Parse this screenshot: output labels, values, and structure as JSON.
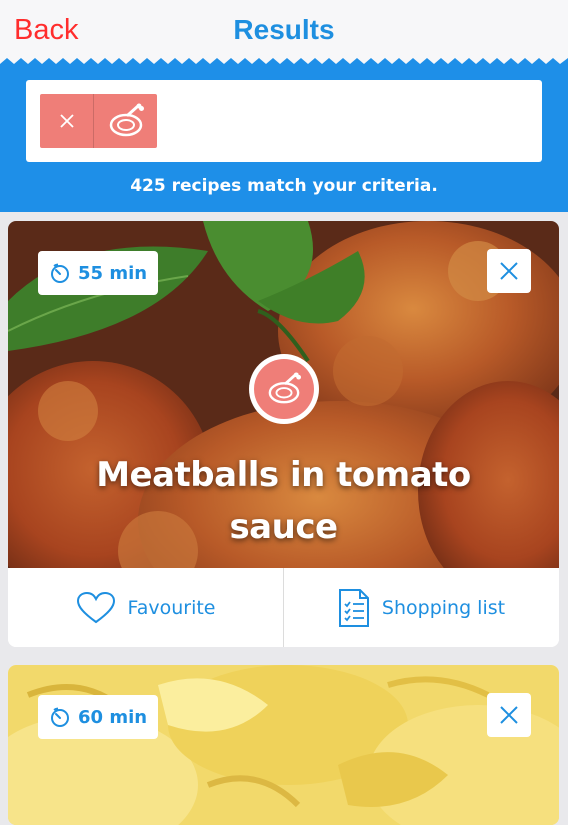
{
  "nav": {
    "back_label": "Back",
    "title": "Results"
  },
  "filter": {
    "chips": [
      {
        "icon": "meat-icon"
      }
    ],
    "match_text": "425 recipes match your criteria."
  },
  "colors": {
    "accent": "#1e8fe0",
    "bar": "#1e8fe8",
    "chip": "#ef7e78",
    "back": "#ff2d2d"
  },
  "recipes": [
    {
      "time": "55 min",
      "title": "Meatballs in tomato sauce",
      "category_icon": "meat-icon",
      "favourite_label": "Favourite",
      "shopping_label": "Shopping list"
    },
    {
      "time": "60 min"
    }
  ]
}
